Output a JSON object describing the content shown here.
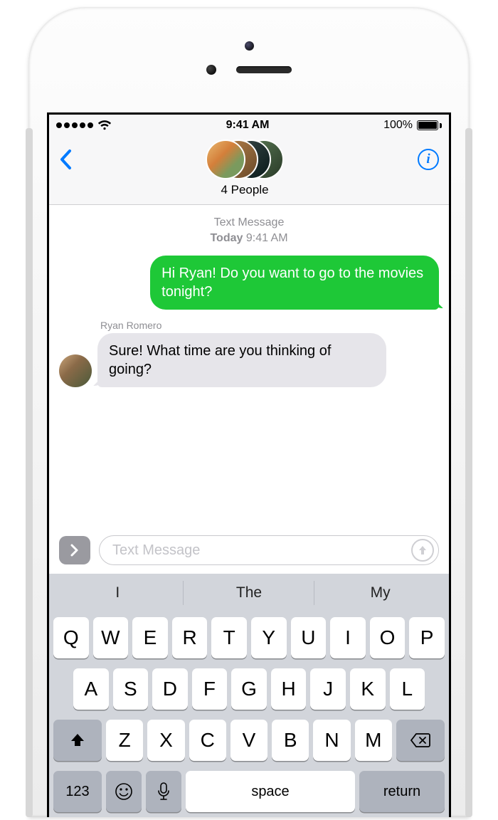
{
  "status": {
    "time": "9:41 AM",
    "battery_pct": "100%"
  },
  "header": {
    "title": "4 People"
  },
  "thread": {
    "meta_line1": "Text Message",
    "meta_line2_prefix": "Today",
    "meta_line2_time": "9:41 AM",
    "outgoing_text": "Hi Ryan! Do you want to go to the movies tonight?",
    "incoming_sender": "Ryan Romero",
    "incoming_text": "Sure! What time are you thinking of going?"
  },
  "input": {
    "placeholder": "Text Message"
  },
  "keyboard": {
    "predictions": [
      "I",
      "The",
      "My"
    ],
    "row1": [
      "Q",
      "W",
      "E",
      "R",
      "T",
      "Y",
      "U",
      "I",
      "O",
      "P"
    ],
    "row2": [
      "A",
      "S",
      "D",
      "F",
      "G",
      "H",
      "J",
      "K",
      "L"
    ],
    "row3": [
      "Z",
      "X",
      "C",
      "V",
      "B",
      "N",
      "M"
    ],
    "num_key": "123",
    "space_key": "space",
    "return_key": "return"
  }
}
